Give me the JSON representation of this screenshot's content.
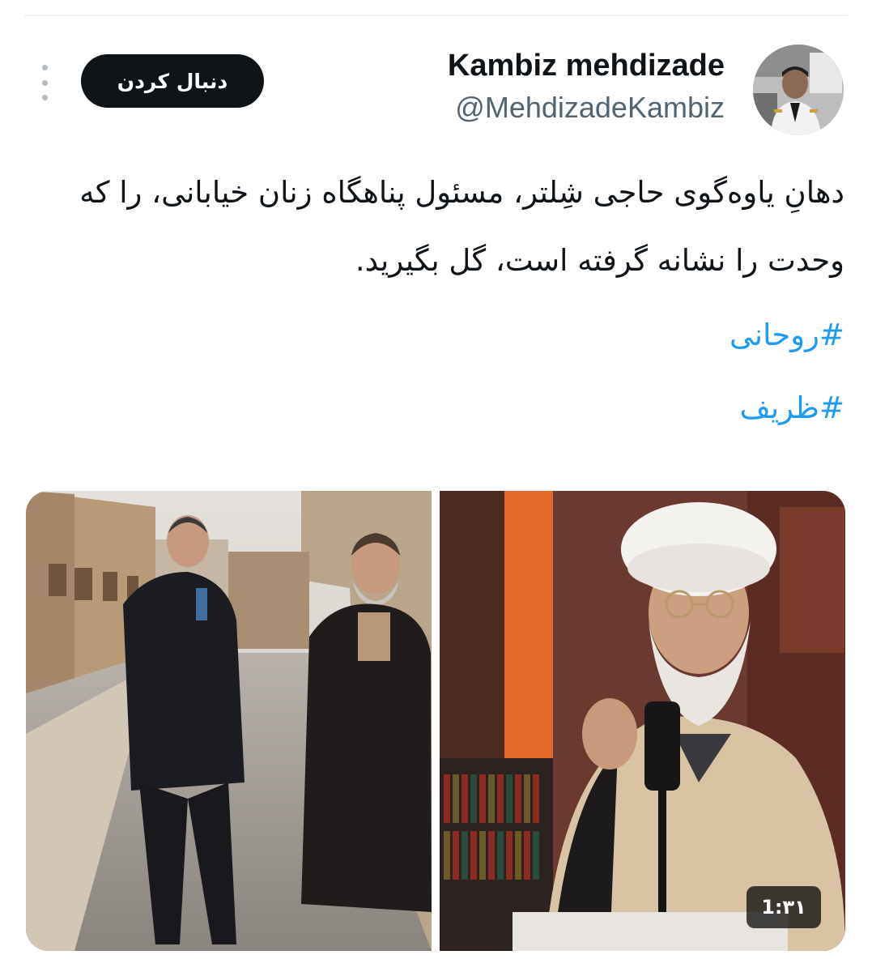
{
  "author": {
    "display_name": "Kambiz mehdizade",
    "handle": "@MehdizadeKambiz"
  },
  "actions": {
    "follow_label": "دنبال کردن"
  },
  "tweet": {
    "text": "دهانِ یاوه‌گوی حاجی شِلتر، مسئول پناهگاه زنان خیابانی، را که وحدت را نشانه گرفته است، گل بگیرید.",
    "hashtags": [
      "#روحانی",
      "#ظریف"
    ]
  },
  "media": {
    "video_duration": "1:۳۱"
  },
  "icons": {
    "avatar": "profile-photo",
    "more": "more-vertical-icon"
  },
  "colors": {
    "link": "#1d9bf0",
    "button_bg": "#0f1419",
    "handle": "#536471"
  }
}
